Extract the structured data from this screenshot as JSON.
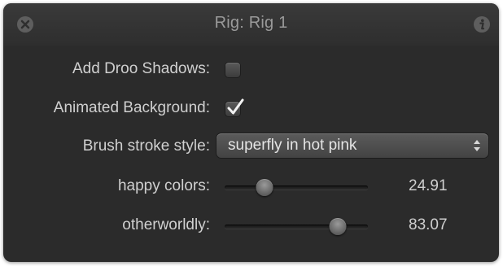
{
  "window": {
    "title": "Rig: Rig 1"
  },
  "fields": {
    "add_droo_shadows": {
      "label": "Add Droo Shadows:",
      "checked": false
    },
    "animated_background": {
      "label": "Animated Background:",
      "checked": true
    },
    "brush_stroke_style": {
      "label": "Brush stroke style:",
      "value": "superfly in hot pink"
    },
    "happy_colors": {
      "label": "happy colors:",
      "value": "24.91",
      "fraction": 0.2491
    },
    "otherworldly": {
      "label": "otherworldly:",
      "value": "83.07",
      "fraction": 0.8307
    }
  },
  "icons": {
    "close": "close-icon",
    "info": "info-icon",
    "checkmark": "checkmark-icon",
    "popup_arrows": "updown-arrows-icon"
  },
  "colors": {
    "panel_bg": "#2b2b2b",
    "label_text": "#d0d0d0",
    "title_text": "#9a9a9a"
  }
}
